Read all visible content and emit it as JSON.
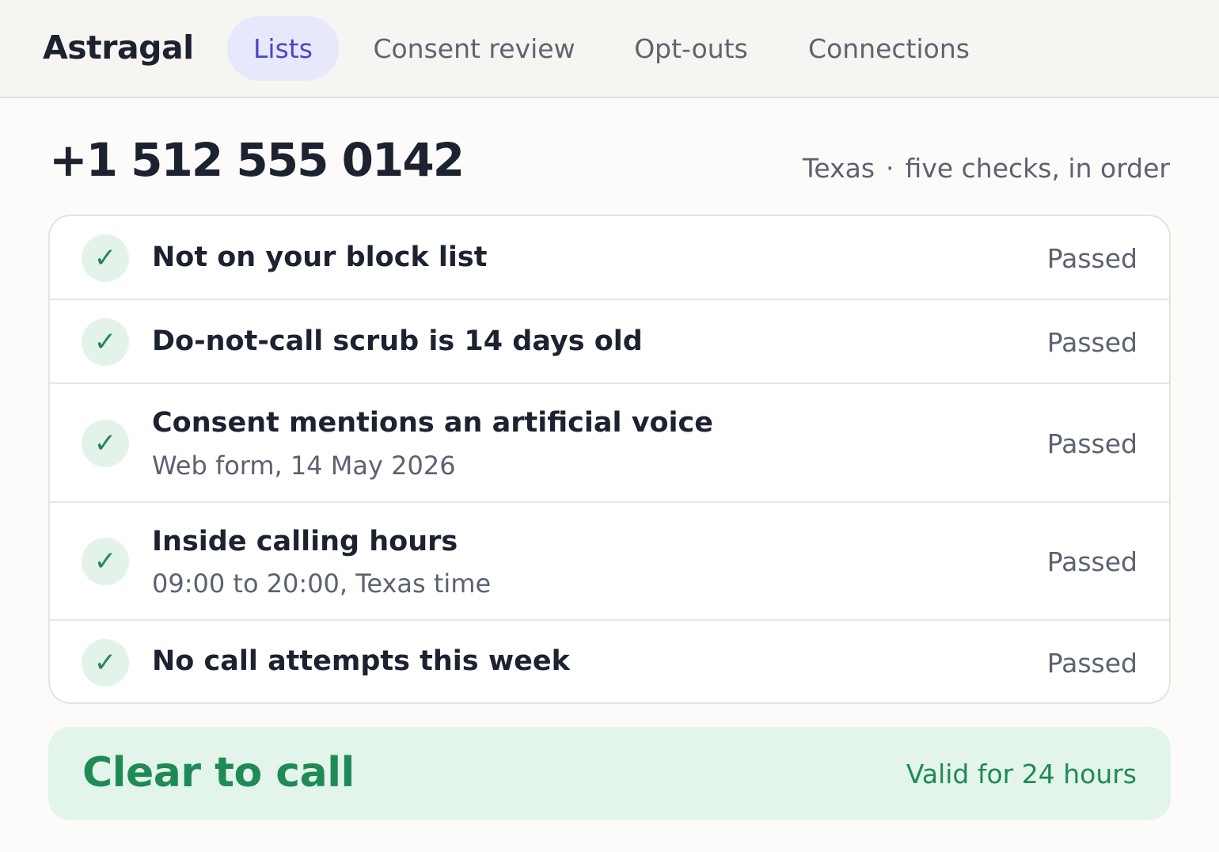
{
  "app": {
    "brand": "Astragal"
  },
  "nav": {
    "tabs": [
      {
        "label": "Lists",
        "active": true
      },
      {
        "label": "Consent review",
        "active": false
      },
      {
        "label": "Opt-outs",
        "active": false
      },
      {
        "label": "Connections",
        "active": false
      }
    ]
  },
  "record": {
    "phone": "+1 512 555 0142",
    "state": "Texas",
    "separator": "·",
    "summary": "five checks, in order"
  },
  "checks": [
    {
      "title": "Not on your block list",
      "subtitle": "",
      "status": "Passed",
      "icon": "check-icon"
    },
    {
      "title": "Do-not-call scrub is 14 days old",
      "subtitle": "",
      "status": "Passed",
      "icon": "check-icon"
    },
    {
      "title": "Consent mentions an artificial voice",
      "subtitle": "Web form, 14 May 2026",
      "status": "Passed",
      "icon": "check-icon"
    },
    {
      "title": "Inside calling hours",
      "subtitle": "09:00 to 20:00, Texas time",
      "status": "Passed",
      "icon": "check-icon"
    },
    {
      "title": "No call attempts this week",
      "subtitle": "",
      "status": "Passed",
      "icon": "check-icon"
    }
  ],
  "verdict": {
    "title": "Clear to call",
    "validity": "Valid for 24 hours"
  },
  "colors": {
    "accent": "#4a46c9",
    "accent_bg": "#e7e8fb",
    "success": "#1f8a55",
    "success_bg": "#e3f4ea"
  }
}
